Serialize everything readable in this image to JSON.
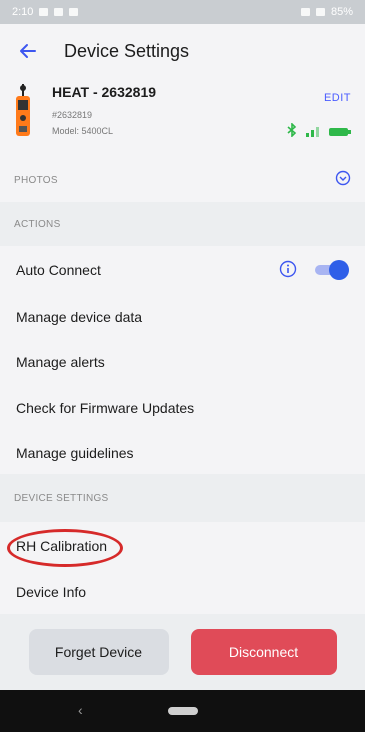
{
  "status_bar": {
    "time": "2:10",
    "right_text": "85%"
  },
  "header": {
    "title": "Device Settings",
    "back_icon": "arrow-left-icon"
  },
  "device": {
    "name": "HEAT - 2632819",
    "serial": "#2632819",
    "model": "Model: 5400CL",
    "edit_label": "EDIT",
    "icons": [
      "bluetooth-icon",
      "signal-icon",
      "battery-icon"
    ]
  },
  "sections": {
    "photos": "PHOTOS",
    "actions": "ACTIONS",
    "device_settings": "DEVICE SETTINGS"
  },
  "actions": {
    "auto_connect": "Auto Connect",
    "auto_connect_on": true,
    "manage_device_data": "Manage device data",
    "manage_alerts": "Manage alerts",
    "check_firmware": "Check for Firmware Updates",
    "manage_guidelines": "Manage guidelines"
  },
  "device_settings": {
    "rh_calibration": "RH Calibration",
    "device_info": "Device Info"
  },
  "footer": {
    "forget_label": "Forget Device",
    "disconnect_label": "Disconnect"
  },
  "colors": {
    "accent": "#2f5fe8",
    "edit": "#4a5cff",
    "disconnect": "#e04b58",
    "highlight": "#d62a2a",
    "status_green": "#2fb84a"
  }
}
